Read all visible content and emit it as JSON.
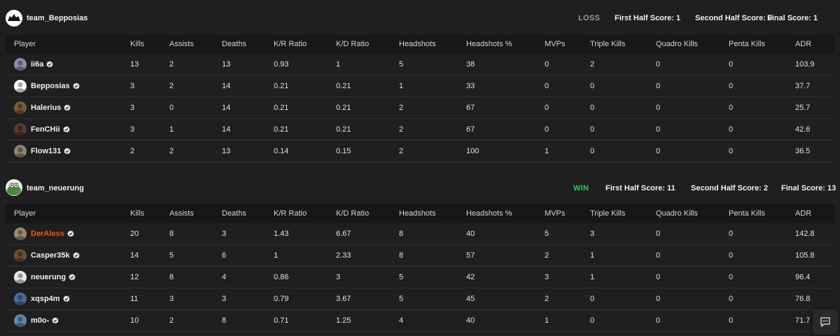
{
  "columns": [
    "Player",
    "Kills",
    "Assists",
    "Deaths",
    "K/R Ratio",
    "K/D Ratio",
    "Headshots",
    "Headshots %",
    "MVPs",
    "Triple Kills",
    "Quadro Kills",
    "Penta Kills",
    "ADR"
  ],
  "teams": [
    {
      "name": "team_Bepposias",
      "result": "LOSS",
      "first_half": "First Half Score: 1",
      "second_half": "Second Half Score: 0",
      "final": "Final Score: 1",
      "players": [
        {
          "name": "ii6a",
          "highlight": false,
          "avatar": "#8a8fa6",
          "stats": [
            "13",
            "2",
            "13",
            "0.93",
            "1",
            "5",
            "38",
            "0",
            "2",
            "0",
            "0",
            "103.9"
          ]
        },
        {
          "name": "Bepposias",
          "highlight": false,
          "avatar": "#ffffff",
          "stats": [
            "3",
            "2",
            "14",
            "0.21",
            "0.21",
            "1",
            "33",
            "0",
            "0",
            "0",
            "0",
            "37.7"
          ]
        },
        {
          "name": "Halerius",
          "highlight": false,
          "avatar": "#7a5a3a",
          "stats": [
            "3",
            "0",
            "14",
            "0.21",
            "0.21",
            "2",
            "67",
            "0",
            "0",
            "0",
            "0",
            "25.7"
          ]
        },
        {
          "name": "FenCHii",
          "highlight": false,
          "avatar": "#5a3a2a",
          "stats": [
            "3",
            "1",
            "14",
            "0.21",
            "0.21",
            "2",
            "67",
            "0",
            "0",
            "0",
            "0",
            "42.6"
          ]
        },
        {
          "name": "Flow131",
          "highlight": false,
          "avatar": "#8c8370",
          "stats": [
            "2",
            "2",
            "13",
            "0.14",
            "0.15",
            "2",
            "100",
            "1",
            "0",
            "0",
            "0",
            "36.5"
          ]
        }
      ]
    },
    {
      "name": "team_neuerung",
      "result": "WIN",
      "first_half": "First Half Score: 11",
      "second_half": "Second Half Score: 2",
      "final": "Final Score: 13",
      "players": [
        {
          "name": "DerAless",
          "highlight": true,
          "avatar": "#9a8a70",
          "stats": [
            "20",
            "8",
            "3",
            "1.43",
            "6.67",
            "8",
            "40",
            "5",
            "3",
            "0",
            "0",
            "142.8"
          ]
        },
        {
          "name": "Casper35k",
          "highlight": false,
          "avatar": "#6a5030",
          "stats": [
            "14",
            "5",
            "6",
            "1",
            "2.33",
            "8",
            "57",
            "2",
            "1",
            "0",
            "0",
            "105.8"
          ]
        },
        {
          "name": "neuerung",
          "highlight": false,
          "avatar": "#e8e8e8",
          "stats": [
            "12",
            "8",
            "4",
            "0.86",
            "3",
            "5",
            "42",
            "3",
            "1",
            "0",
            "0",
            "96.4"
          ]
        },
        {
          "name": "xqsp4m",
          "highlight": false,
          "avatar": "#4a6aa0",
          "stats": [
            "11",
            "3",
            "3",
            "0.79",
            "3.67",
            "5",
            "45",
            "2",
            "0",
            "0",
            "0",
            "76.8"
          ]
        },
        {
          "name": "m0o-",
          "highlight": false,
          "avatar": "#5a8ab0",
          "stats": [
            "10",
            "2",
            "8",
            "0.71",
            "1.25",
            "4",
            "40",
            "1",
            "0",
            "0",
            "0",
            "71.7"
          ]
        }
      ]
    }
  ],
  "icons": {
    "verified": "verified-check-icon",
    "chat": "chat-icon"
  },
  "colors": {
    "win": "#32c95a",
    "loss": "#9a9a9a",
    "highlight_player": "#f2551e",
    "background": "#1f1f1f",
    "header_row": "#171717"
  }
}
